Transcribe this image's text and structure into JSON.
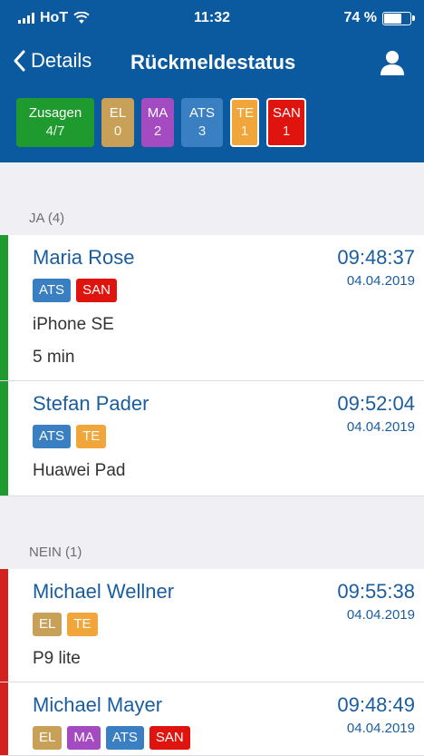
{
  "status": {
    "carrier": "HoT",
    "time": "11:32",
    "battery": "74 %",
    "battery_level": 0.74
  },
  "nav": {
    "back_label": "Details",
    "title": "Rückmeldestatus"
  },
  "summary": [
    {
      "label": "Zusagen",
      "count": "4/7",
      "color": "#1f9a2e",
      "outlined": false
    },
    {
      "label": "EL",
      "count": "0",
      "color": "#c9a058",
      "outlined": false
    },
    {
      "label": "MA",
      "count": "2",
      "color": "#a54bc2",
      "outlined": false
    },
    {
      "label": "ATS",
      "count": "3",
      "color": "#3a7fc2",
      "outlined": false
    },
    {
      "label": "TE",
      "count": "1",
      "color": "#f0a63a",
      "outlined": true
    },
    {
      "label": "SAN",
      "count": "1",
      "color": "#e0140f",
      "outlined": true
    }
  ],
  "tag_colors": {
    "EL": "#c9a058",
    "MA": "#a54bc2",
    "ATS": "#3a7fc2",
    "TE": "#f0a63a",
    "SAN": "#e0140f"
  },
  "sections": [
    {
      "header": "JA (4)",
      "stripe_color": "#1f9a2e",
      "rows": [
        {
          "name": "Maria Rose",
          "time": "09:48:37",
          "date": "04.04.2019",
          "tags": [
            "ATS",
            "SAN"
          ],
          "lines": [
            "iPhone SE",
            "5 min"
          ]
        },
        {
          "name": "Stefan Pader",
          "time": "09:52:04",
          "date": "04.04.2019",
          "tags": [
            "ATS",
            "TE"
          ],
          "lines": [
            "Huawei Pad"
          ]
        }
      ]
    },
    {
      "header": "NEIN (1)",
      "stripe_color": "#d3221d",
      "rows": [
        {
          "name": "Michael Wellner",
          "time": "09:55:38",
          "date": "04.04.2019",
          "tags": [
            "EL",
            "TE"
          ],
          "lines": [
            "P9 lite"
          ]
        },
        {
          "name": "Michael Mayer",
          "time": "09:48:49",
          "date": "04.04.2019",
          "tags": [
            "EL",
            "MA",
            "ATS",
            "SAN"
          ],
          "lines": []
        }
      ]
    }
  ]
}
